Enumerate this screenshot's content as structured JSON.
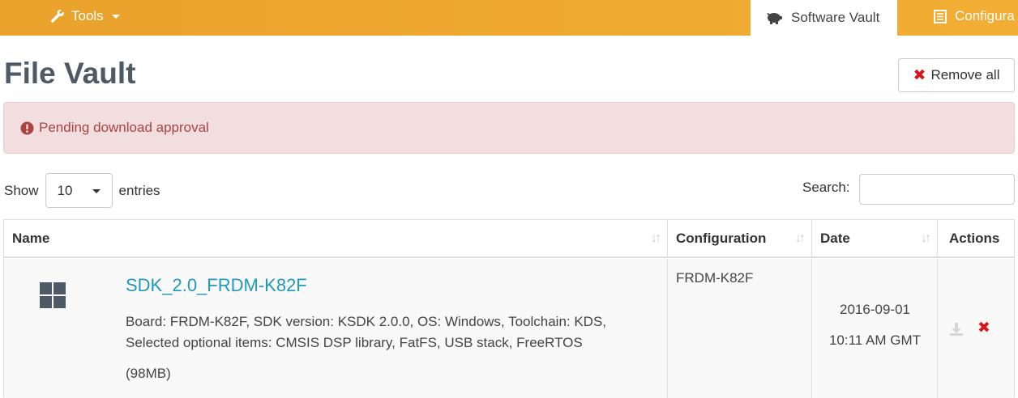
{
  "nav": {
    "tools_label": "Tools",
    "active_tab": "Software Vault",
    "config_tab": "Configura"
  },
  "page": {
    "title": "File Vault",
    "remove_all_label": "Remove all"
  },
  "alert": {
    "message": "Pending download approval"
  },
  "controls": {
    "show_label": "Show",
    "entries_value": "10",
    "entries_label": "entries",
    "search_label": "Search:",
    "search_value": ""
  },
  "table": {
    "columns": [
      "Name",
      "Configuration",
      "Date",
      "Actions"
    ],
    "rows": [
      {
        "name": "SDK_2.0_FRDM-K82F",
        "description_line1": "Board: FRDM-K82F, SDK version: KSDK 2.0.0, OS: Windows, Toolchain: KDS,",
        "description_line2": "Selected optional items: CMSIS DSP library, FatFS, USB stack, FreeRTOS",
        "size": "(98MB)",
        "configuration": "FRDM-K82F",
        "date": "2016-09-01",
        "time": "10:11 AM GMT"
      }
    ]
  },
  "colors": {
    "nav_bg": "#eea930",
    "alert_bg": "#f2dede",
    "alert_text": "#a94442",
    "link": "#2199bf",
    "delete_red": "#d9141b"
  }
}
